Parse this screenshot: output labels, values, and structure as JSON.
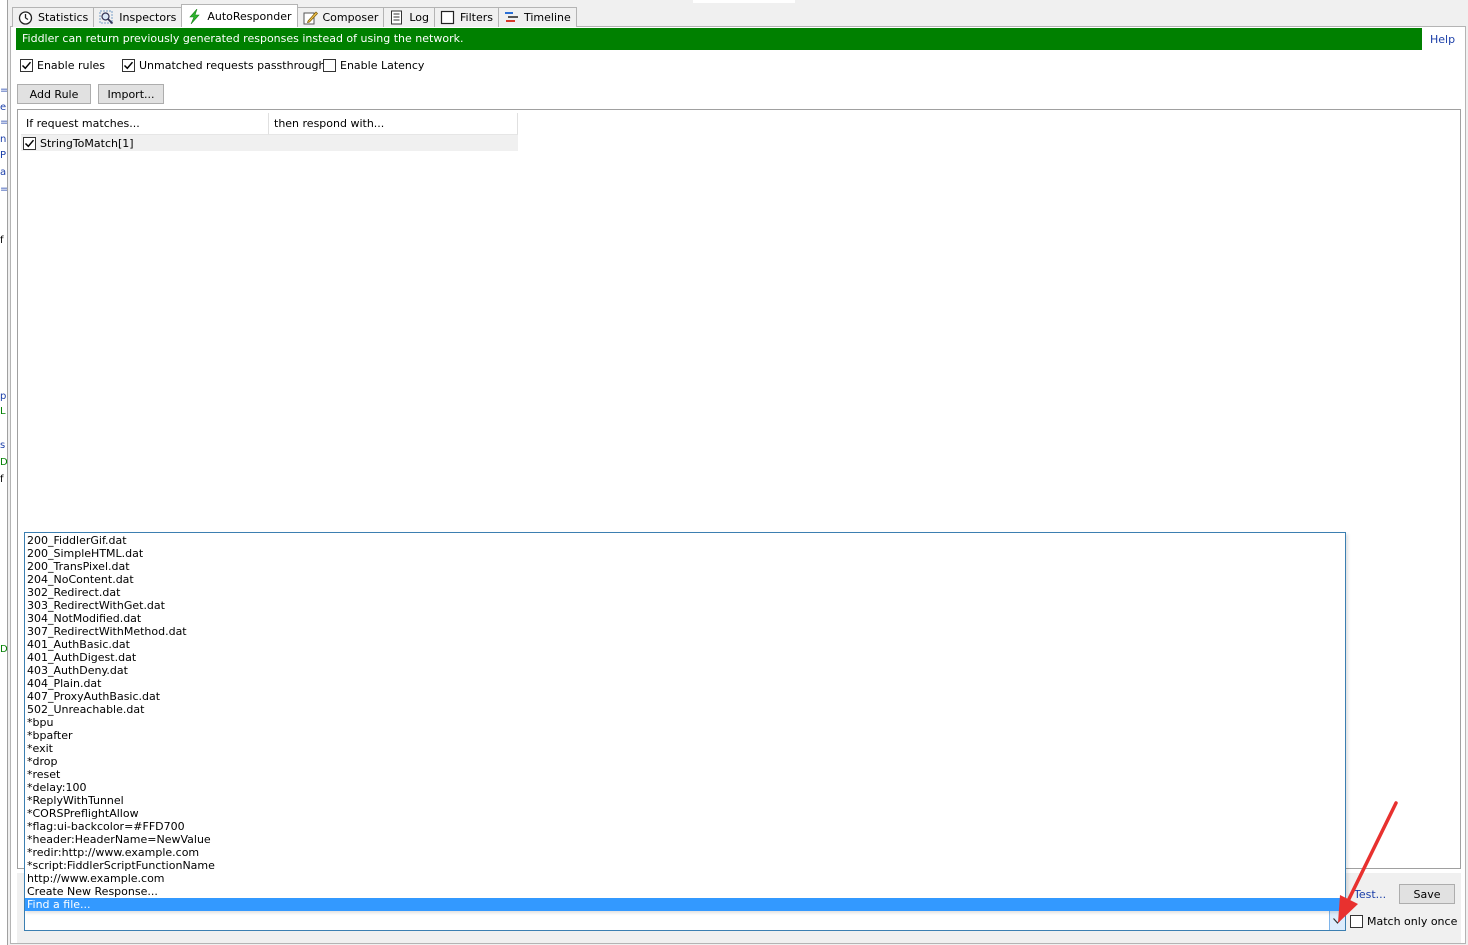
{
  "left_strip": [
    "=",
    "e",
    "=",
    "n",
    "P",
    "a",
    "=",
    "f",
    "p",
    "L",
    "s",
    "D",
    "f",
    "D"
  ],
  "tabs": [
    {
      "label": "Statistics",
      "icon": "stopwatch-icon"
    },
    {
      "label": "Inspectors",
      "icon": "magnifier-icon"
    },
    {
      "label": "AutoResponder",
      "icon": "lightning-icon",
      "active": true
    },
    {
      "label": "Composer",
      "icon": "pencil-icon"
    },
    {
      "label": "Log",
      "icon": "log-icon"
    },
    {
      "label": "Filters",
      "icon": "checkbox-icon"
    },
    {
      "label": "Timeline",
      "icon": "timeline-icon"
    }
  ],
  "banner": {
    "text": "Fiddler can return previously generated responses instead of using the network.",
    "color": "#008000"
  },
  "help_link": "Help",
  "options": {
    "enable_rules": {
      "label": "Enable rules",
      "checked": true
    },
    "unmatched_passthrough": {
      "label": "Unmatched requests passthrough",
      "checked": true
    },
    "enable_latency": {
      "label": "Enable Latency",
      "checked": false
    }
  },
  "buttons": {
    "add_rule": "Add Rule",
    "import": "Import...",
    "test": "Test...",
    "save": "Save"
  },
  "rules_grid": {
    "columns": [
      "If request matches...",
      "then respond with..."
    ],
    "rows": [
      {
        "match": "StringToMatch[1]",
        "respond": "",
        "checked": true
      }
    ]
  },
  "match_only_once": {
    "label": "Match only once",
    "checked": false
  },
  "response_dropdown": {
    "items": [
      "200_FiddlerGif.dat",
      "200_SimpleHTML.dat",
      "200_TransPixel.dat",
      "204_NoContent.dat",
      "302_Redirect.dat",
      "303_RedirectWithGet.dat",
      "304_NotModified.dat",
      "307_RedirectWithMethod.dat",
      "401_AuthBasic.dat",
      "401_AuthDigest.dat",
      "403_AuthDeny.dat",
      "404_Plain.dat",
      "407_ProxyAuthBasic.dat",
      "502_Unreachable.dat",
      "*bpu",
      "*bpafter",
      "*exit",
      "*drop",
      "*reset",
      "*delay:100",
      "*ReplyWithTunnel",
      "*CORSPreflightAllow",
      "*flag:ui-backcolor=#FFD700",
      "*header:HeaderName=NewValue",
      "*redir:http://www.example.com",
      "*script:FiddlerScriptFunctionName",
      "http://www.example.com",
      "Create New Response...",
      "Find a file..."
    ],
    "selected_index": 28,
    "current_value": "",
    "selection_color": "#3399ff"
  },
  "annotation_color": "#e8312f"
}
